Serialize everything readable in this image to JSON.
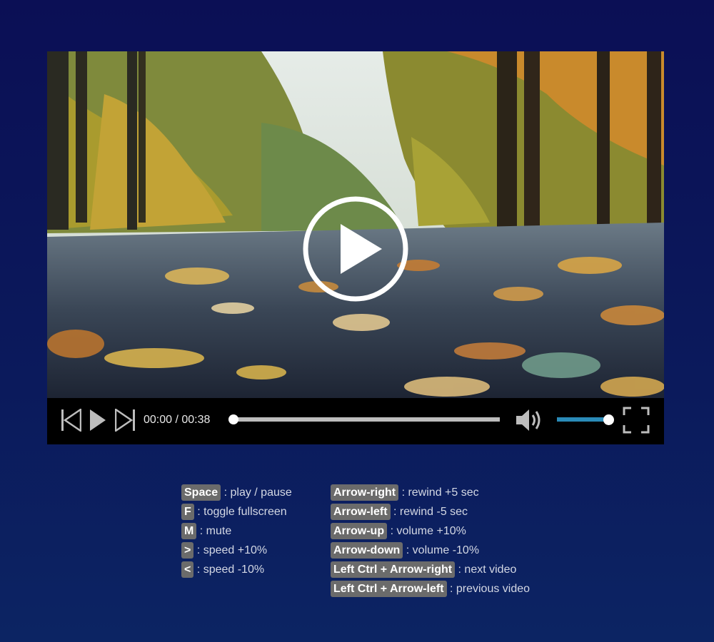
{
  "player": {
    "time_display": "00:00 / 00:38",
    "progress": 0.0,
    "volume": 1.0,
    "colors": {
      "controls_bg": "#000000",
      "progress_track": "#bdbdbd",
      "volume_fill": "#2a8bb8",
      "icon": "#bdbdbd"
    },
    "icons": {
      "big_play": "play-circle-icon",
      "prev": "skip-previous-icon",
      "play": "play-icon",
      "next": "skip-next-icon",
      "volume": "volume-icon",
      "fullscreen": "fullscreen-icon"
    }
  },
  "shortcuts": {
    "left": [
      {
        "key": "Space",
        "desc": ": play / pause"
      },
      {
        "key": "F",
        "desc": ": toggle fullscreen"
      },
      {
        "key": "M",
        "desc": ": mute"
      },
      {
        "key": ">",
        "desc": ": speed +10%"
      },
      {
        "key": "<",
        "desc": ": speed -10%"
      }
    ],
    "right": [
      {
        "key": "Arrow-right",
        "desc": ": rewind +5 sec"
      },
      {
        "key": "Arrow-left",
        "desc": ": rewind -5 sec"
      },
      {
        "key": "Arrow-up",
        "desc": ": volume +10%"
      },
      {
        "key": "Arrow-down",
        "desc": ": volume -10%"
      },
      {
        "key": "Left Ctrl + Arrow-right",
        "desc": ": next video"
      },
      {
        "key": "Left Ctrl + Arrow-left",
        "desc": ": previous video"
      }
    ]
  }
}
